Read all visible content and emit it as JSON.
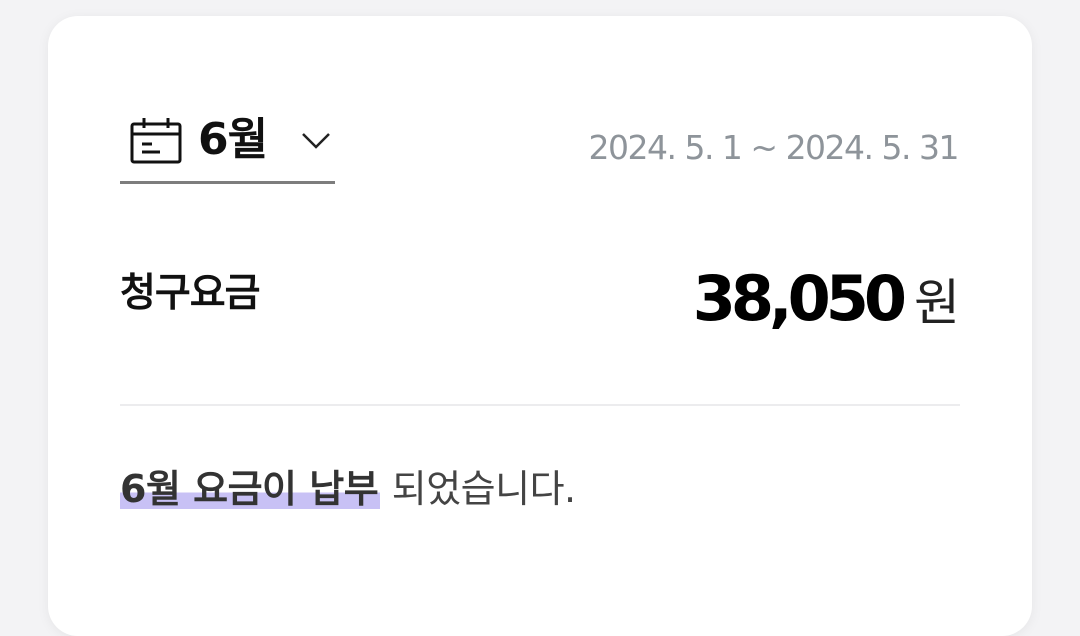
{
  "month_selector": {
    "label": "6월",
    "icon": "calendar-icon",
    "dropdown_icon": "chevron-down-icon"
  },
  "billing_period": "2024. 5. 1 ~ 2024. 5. 31",
  "bill": {
    "label": "청구요금",
    "amount": "38,050",
    "unit": "원"
  },
  "payment_status": {
    "highlighted": "6월 요금이 납부",
    "rest": " 되었습니다.",
    "highlight_color": "#c8c1f5"
  }
}
